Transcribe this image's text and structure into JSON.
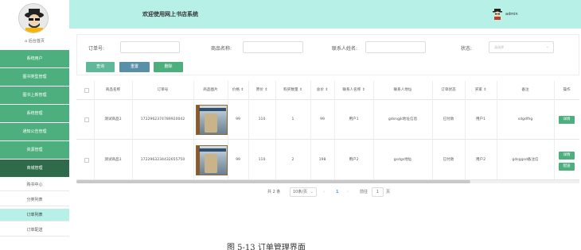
{
  "header": {
    "title": "欢迎使用网上书店系统",
    "user": "admin"
  },
  "sidebar": {
    "home": "后台首页",
    "items": [
      "系统用户",
      "图书类型管理",
      "图书上新管理",
      "系统管理",
      "通知公告管理",
      "资源管理",
      "商城管理"
    ],
    "subitems": [
      "购书中心",
      "分类列表",
      "订单列表",
      "订单配送"
    ],
    "active_sub": "订单列表"
  },
  "filter": {
    "order_no_label": "订单号:",
    "product_name_label": "商品名称:",
    "contact_label": "联系人姓名:",
    "status_label": "状态:",
    "status_placeholder": "请选择",
    "query_button": "查询",
    "reset_button": "重置",
    "delete_button": "删除"
  },
  "table": {
    "columns": [
      "商品名称",
      "订单号",
      "商品图片",
      "价格 ⇕",
      "原价 ⇕",
      "购买数量 ⇕",
      "总价 ⇕",
      "联系人名称 ⇕",
      "联系人地址",
      "订单状态",
      "买家 ⇕",
      "备注",
      "操作"
    ],
    "rows": [
      {
        "name": "测试商品1",
        "order_no": "1722962374789920042",
        "price": "99",
        "orig": "110",
        "qty": "1",
        "total": "99",
        "contact": "用户1",
        "address": "gdsngjk地址信息",
        "status": "已付款",
        "buyer": "用户1",
        "note": "sdgdfhg",
        "ops": [
          "详情"
        ]
      },
      {
        "name": "测试商品1",
        "order_no": "1722963234432655750",
        "price": "99",
        "orig": "110",
        "qty": "2",
        "total": "198",
        "contact": "用户2",
        "address": "gsdgs地址",
        "status": "已付款",
        "buyer": "用户2",
        "note": "gdsggsd备注信",
        "ops": [
          "详情",
          "配送"
        ]
      }
    ]
  },
  "pager": {
    "total": "共 2 条",
    "page_size": "10条/页",
    "prev": "‹",
    "current": "1",
    "next": "›",
    "goto": "前往",
    "goto_value": "1",
    "page_unit": "页"
  },
  "caption": "图 5-13  订单管理界面",
  "colors": {
    "header_bg": "#b7f0e6",
    "sidebar_green": "#4caf7d",
    "sidebar_dark": "#2e6b4a",
    "query_btn": "#5fb89a",
    "reset_btn": "#5a8fa8",
    "delete_btn": "#4caf7d"
  }
}
